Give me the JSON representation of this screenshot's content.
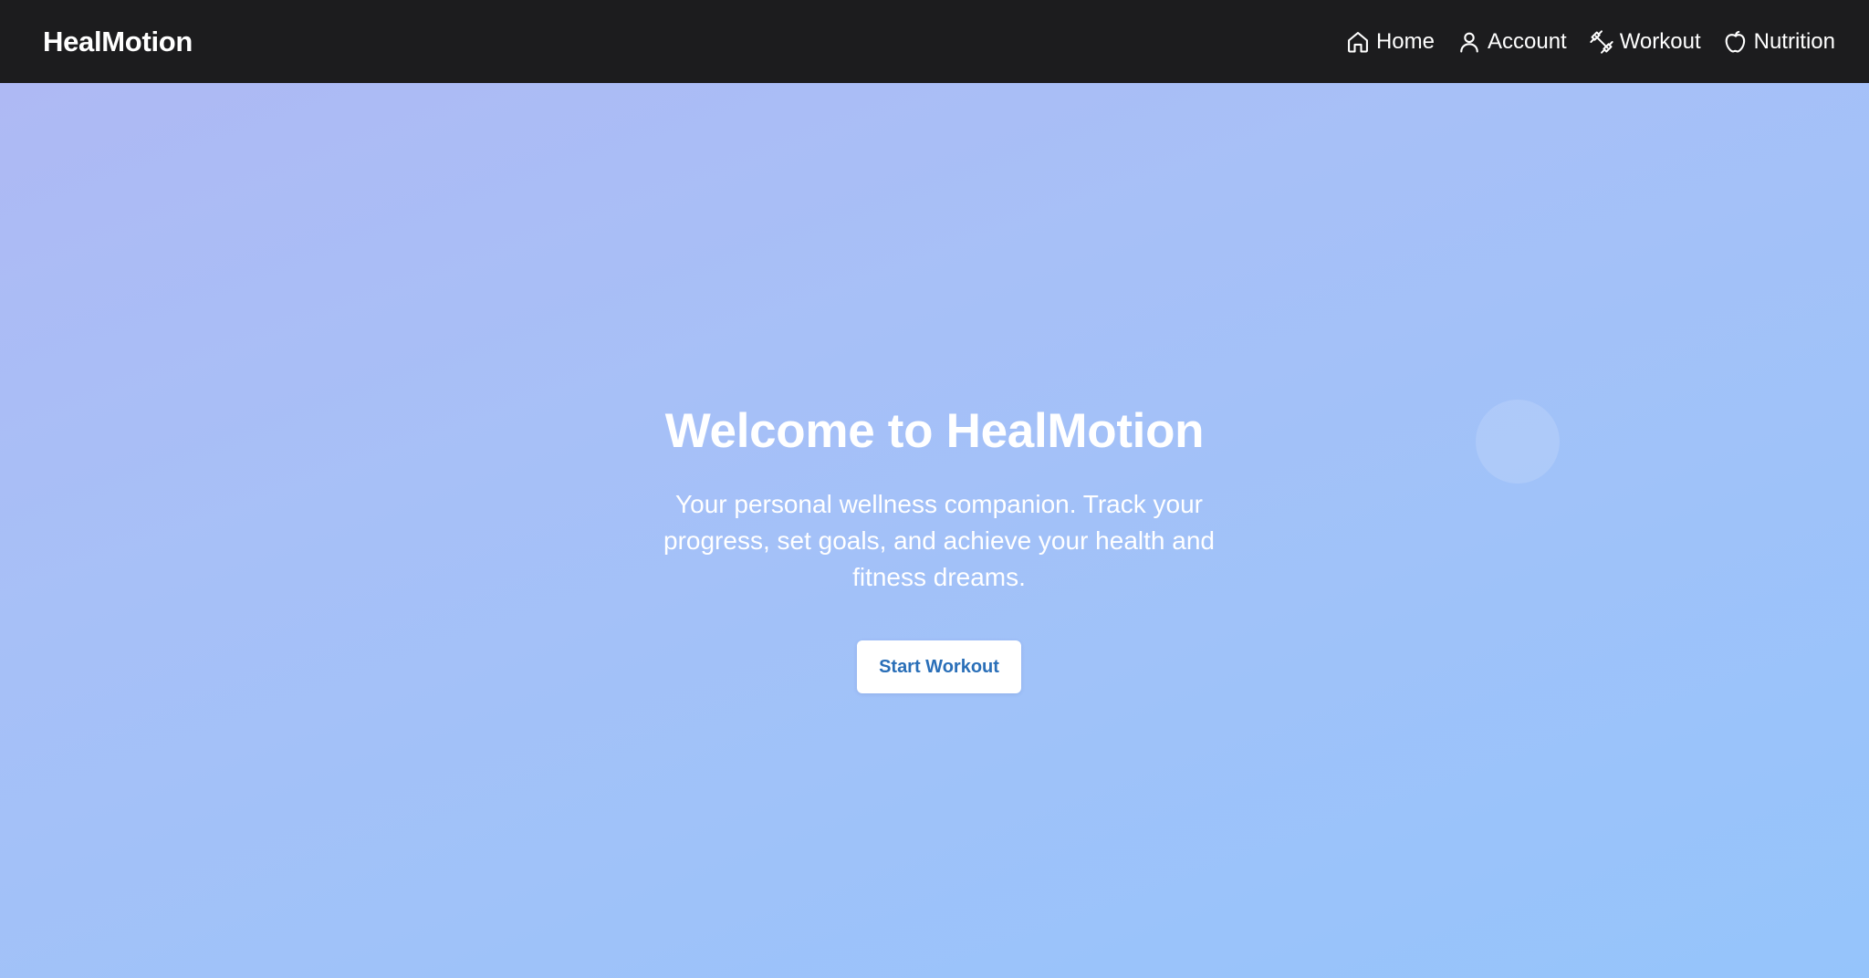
{
  "navbar": {
    "brand": "HealMotion",
    "links": [
      {
        "label": "Home",
        "icon": "home-icon"
      },
      {
        "label": "Account",
        "icon": "user-icon"
      },
      {
        "label": "Workout",
        "icon": "dumbbell-icon"
      },
      {
        "label": "Nutrition",
        "icon": "apple-icon"
      }
    ]
  },
  "hero": {
    "title": "Welcome to HealMotion",
    "subtitle": "Your personal wellness companion. Track your progress, set goals, and achieve your health and fitness dreams.",
    "cta_label": "Start Workout"
  },
  "colors": {
    "navbar_bg": "#1c1c1e",
    "hero_gradient_start": "#aeb9f4",
    "hero_gradient_end": "#95c4fb",
    "cta_text": "#2a6fb8"
  }
}
